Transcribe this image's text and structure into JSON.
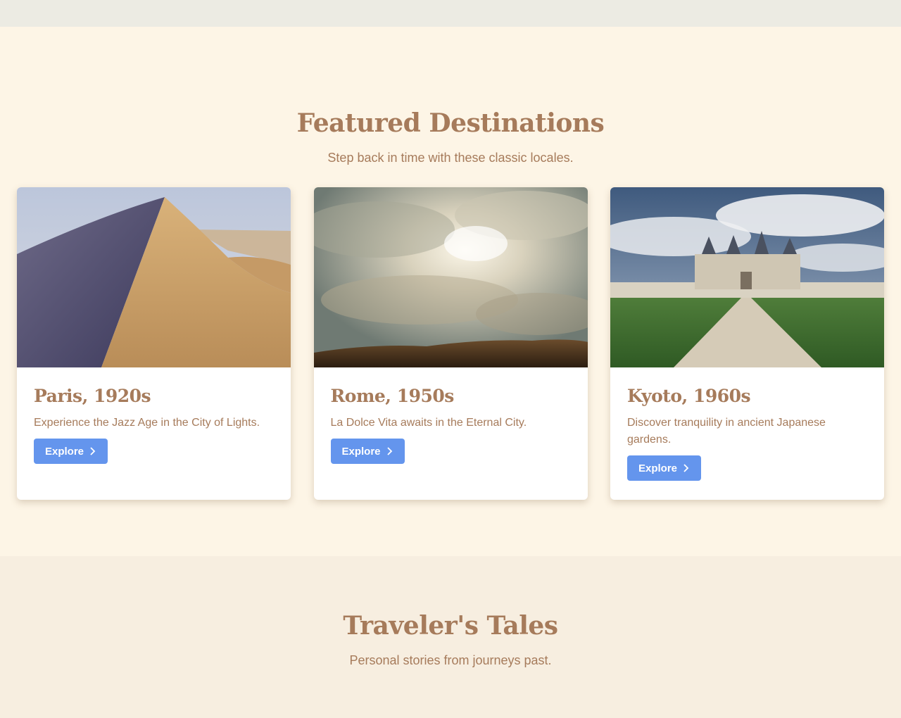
{
  "featured": {
    "title": "Featured Destinations",
    "subtitle": "Step back in time with these classic locales."
  },
  "destinations": [
    {
      "title": "Paris, 1920s",
      "description": "Experience the Jazz Age in the City of Lights.",
      "button": "Explore",
      "image": "desert-dune-photo"
    },
    {
      "title": "Rome, 1950s",
      "description": "La Dolce Vita awaits in the Eternal City.",
      "button": "Explore",
      "image": "cloudy-sky-photo"
    },
    {
      "title": "Kyoto, 1960s",
      "description": "Discover tranquility in ancient Japanese gardens.",
      "button": "Explore",
      "image": "chateau-photo"
    }
  ],
  "tales": {
    "title": "Traveler's Tales",
    "subtitle": "Personal stories from journeys past."
  },
  "colors": {
    "accent": "#a67b5b",
    "button": "#6495ed",
    "background": "#fdf5e6",
    "tales_background": "#f7eee0"
  },
  "icons": {
    "button_icon": "chevron-right-icon"
  }
}
